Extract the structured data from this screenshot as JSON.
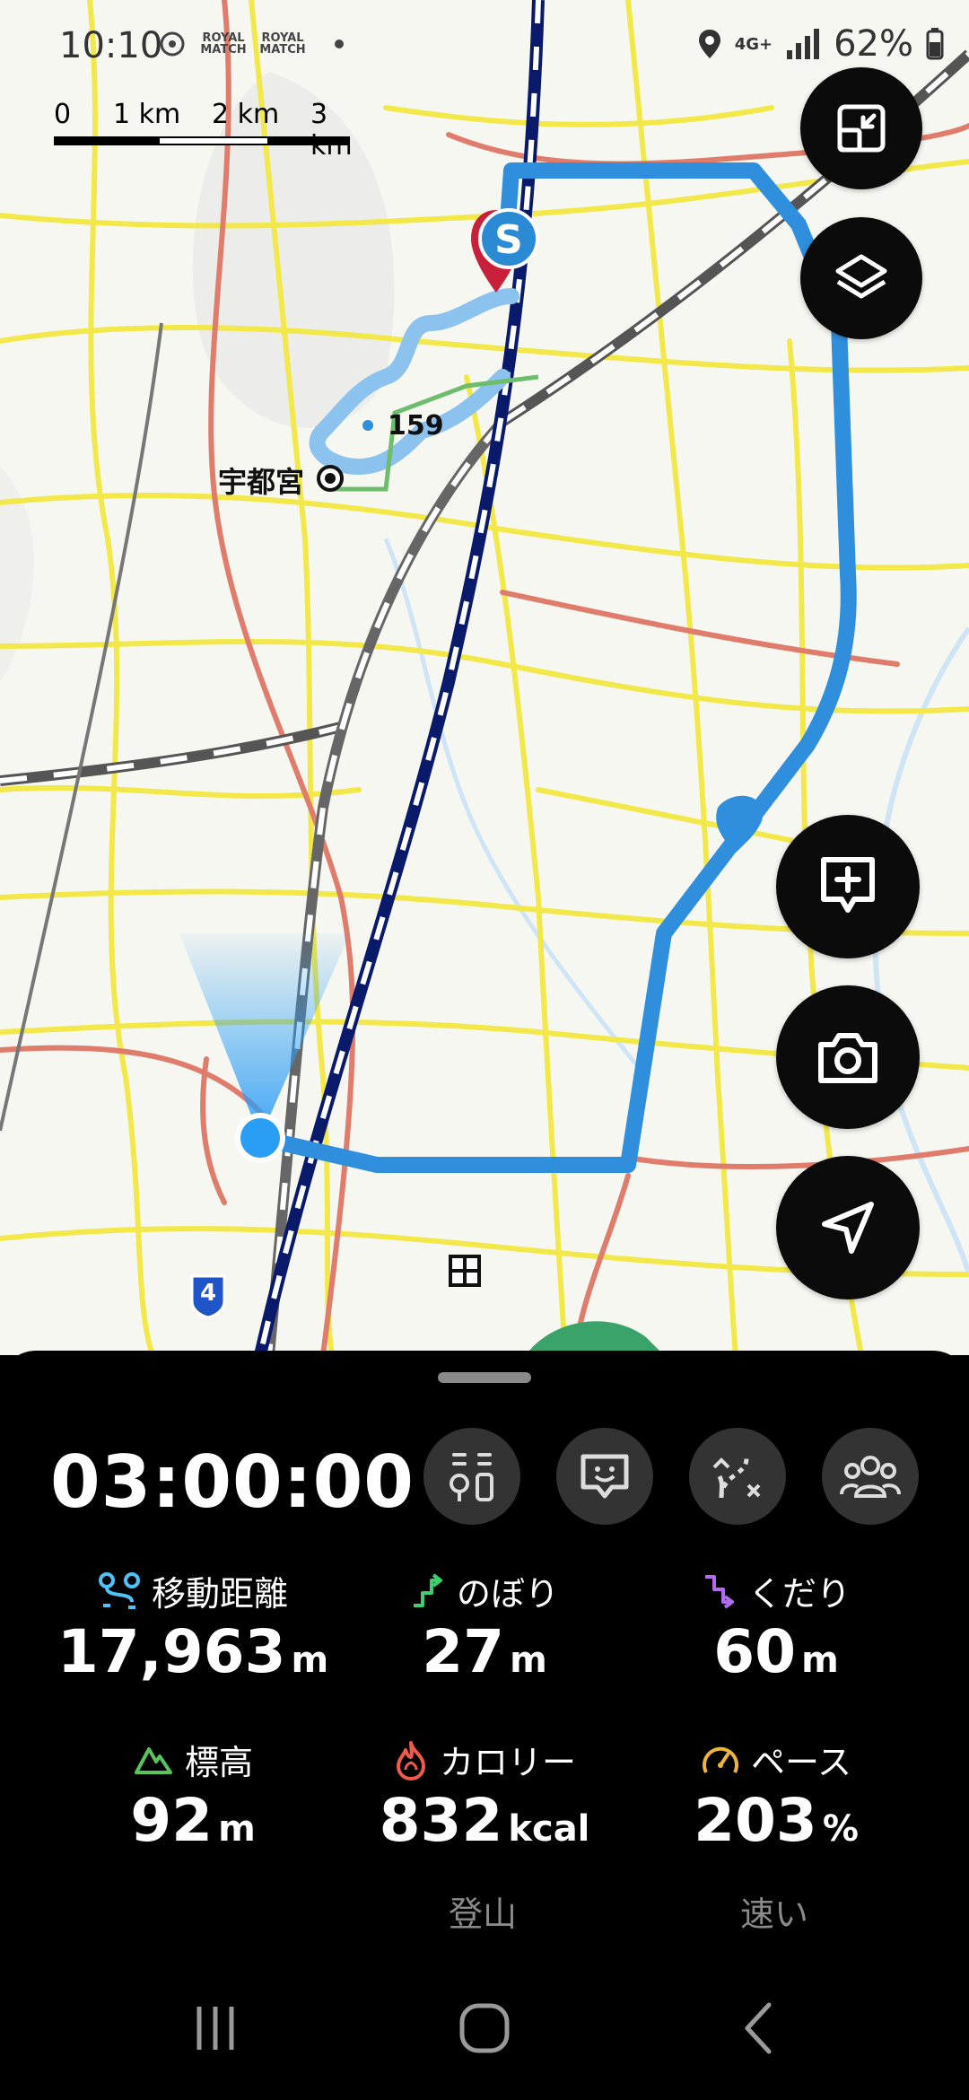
{
  "status_bar": {
    "time": "10:10",
    "app_badge_1": "ROYAL MATCH",
    "app_badge_2": "ROYAL MATCH",
    "network": "4G+",
    "battery": "62%"
  },
  "map": {
    "scale": [
      "0",
      "1 km",
      "2 km",
      "3 km"
    ],
    "city_label": "宇都宮",
    "waypoint_label": "159",
    "road_shield": "4",
    "start_marker": "S",
    "buttons": [
      "expand-icon",
      "layers-icon",
      "add-note-icon",
      "camera-icon",
      "navigate-icon"
    ]
  },
  "panel": {
    "timer": "03:00:00",
    "tools": [
      "route-guide-icon",
      "message-icon",
      "off-route-icon",
      "group-icon"
    ],
    "stats": [
      {
        "label": "移動距離",
        "value": "17,963",
        "unit": "m",
        "icon": "distance-icon",
        "icon_color": "#4fc3f7"
      },
      {
        "label": "のぼり",
        "value": "27",
        "unit": "m",
        "icon": "ascent-icon",
        "icon_color": "#3ccf6c"
      },
      {
        "label": "くだり",
        "value": "60",
        "unit": "m",
        "icon": "descent-icon",
        "icon_color": "#b36cf0"
      },
      {
        "label": "標高",
        "value": "92",
        "unit": "m",
        "icon": "elevation-icon",
        "icon_color": "#5cc25c"
      },
      {
        "label": "カロリー",
        "value": "832",
        "unit": "kcal",
        "icon": "calorie-icon",
        "icon_color": "#f05a4a"
      },
      {
        "label": "ペース",
        "value": "203",
        "unit": "%",
        "icon": "pace-icon",
        "icon_color": "#f0b43c"
      }
    ],
    "calorie_note": "登山",
    "pace_note": "速い"
  },
  "colors": {
    "route": "#2f8fdc",
    "accent_blue": "#2a9df4",
    "panel_bg": "#000000"
  }
}
